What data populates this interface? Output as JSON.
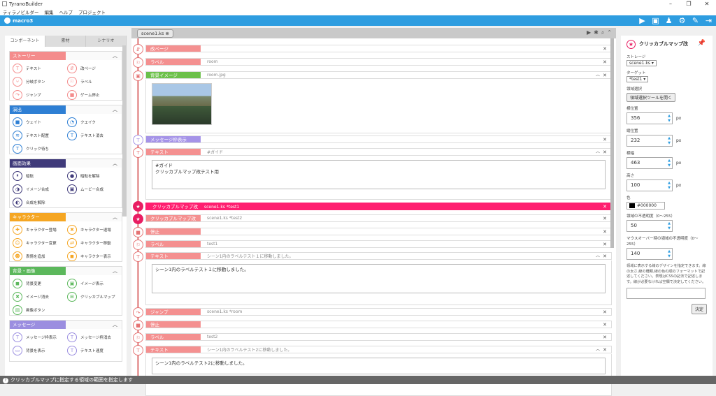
{
  "window": {
    "title": "TyranoBuilder"
  },
  "menu": [
    "ティラノビルダー",
    "編集",
    "ヘルプ",
    "プロジェクト"
  ],
  "toolbar": {
    "project": "macro3"
  },
  "left": {
    "tabs": [
      "コンポーネント",
      "素材",
      "シナリオ"
    ],
    "categories": [
      {
        "label": "ストーリー",
        "color": "#f48c8c",
        "items": [
          "テキスト",
          "改ページ",
          "分岐ボタン",
          "ラベル",
          "ジャンプ",
          "ゲーム停止"
        ]
      },
      {
        "label": "演出",
        "color": "#2e7fd4",
        "items": [
          "ウェイト",
          "クエイク",
          "テキスト配置",
          "テキスト消去",
          "クリック待ち"
        ]
      },
      {
        "label": "画面効果",
        "color": "#3f3a7a",
        "items": [
          "暗転",
          "暗転を解除",
          "イメージ合成",
          "ムービー合成",
          "合成を解除"
        ]
      },
      {
        "label": "キャラクター",
        "color": "#f5a623",
        "items": [
          "キャラクター登場",
          "キャラクター退場",
          "キャラクター変更",
          "キャラクター移動",
          "表情を追加",
          "キャラクター表示"
        ]
      },
      {
        "label": "背景・画像",
        "color": "#5cb85c",
        "items": [
          "背景変更",
          "イメージ表示",
          "イメージ消去",
          "クリッカブルマップ",
          "画像ボタン"
        ]
      },
      {
        "label": "メッセージ",
        "color": "#9b8ee0",
        "items": [
          "メッセージ枠表示",
          "メッセージ枠消去",
          "背景を表示",
          "テキスト速度"
        ]
      }
    ]
  },
  "center": {
    "tab": "scene1.ks",
    "rows": [
      {
        "tag": "改ページ",
        "value": "",
        "color": "#f49090"
      },
      {
        "tag": "ラベル",
        "value": "room",
        "color": "#f49090"
      },
      {
        "tag": "背景イメージ",
        "value": "room.jpg",
        "color": "#6cc04a"
      },
      {
        "tag": "メッセージ枠表示",
        "value": "",
        "color": "#a593e8"
      },
      {
        "tag": "テキスト",
        "value": "#ガイド",
        "color": "#f49090",
        "text": "#ガイド\nクリッカブルマップ改テスト用"
      },
      {
        "tag": "クリッカブルマップ改",
        "value": "scene1.ks *test1",
        "color": "#ff1f70"
      },
      {
        "tag": "クリッカブルマップ改",
        "value": "scene1.ks *test2",
        "color": "#f49090"
      },
      {
        "tag": "停止",
        "value": "",
        "color": "#f49090"
      },
      {
        "tag": "ラベル",
        "value": "test1",
        "color": "#f49090"
      },
      {
        "tag": "テキスト",
        "value": "シーン1内のラベルテスト１に移動しました。",
        "color": "#f49090",
        "text": "シーン1内のラベルテスト１に移動しました。"
      },
      {
        "tag": "ジャンプ",
        "value": "scene1.ks *room",
        "color": "#f49090"
      },
      {
        "tag": "停止",
        "value": "",
        "color": "#f49090"
      },
      {
        "tag": "ラベル",
        "value": "test2",
        "color": "#f49090"
      },
      {
        "tag": "テキスト",
        "value": "シーン1内のラベルテスト2に移動しました。",
        "color": "#f49090",
        "text": "シーン1内のラベルテスト2に移動しました。"
      }
    ]
  },
  "right": {
    "title": "クリッカブルマップ改",
    "storage_label": "ストレージ",
    "storage_value": "scene1.ks",
    "target_label": "ターゲット",
    "target_value": "*test1",
    "area_label": "領域選択",
    "area_button": "領域選択ツールを開く",
    "x_label": "横位置",
    "x_value": "356",
    "y_label": "縦位置",
    "y_value": "232",
    "w_label": "横幅",
    "w_value": "463",
    "h_label": "高さ",
    "h_value": "100",
    "unit": "px",
    "color_label": "色",
    "color_value": "#000000",
    "opacity_label": "領域の不透明度（0～255）",
    "opacity_value": "50",
    "hover_label": "マウスオーバー時の領域の不透明度（0～255）",
    "hover_value": "140",
    "desc": "領域に表示する線のデザインを指定できます。線の太さ,線の種類,線の色の順のフォーマットで記述してください。表現はCSSの記法で記述します。線が必要なければ空欄で決定してください。",
    "ok": "決定"
  },
  "status": "クリッカブルマップに指定する領域の範囲を指定します"
}
